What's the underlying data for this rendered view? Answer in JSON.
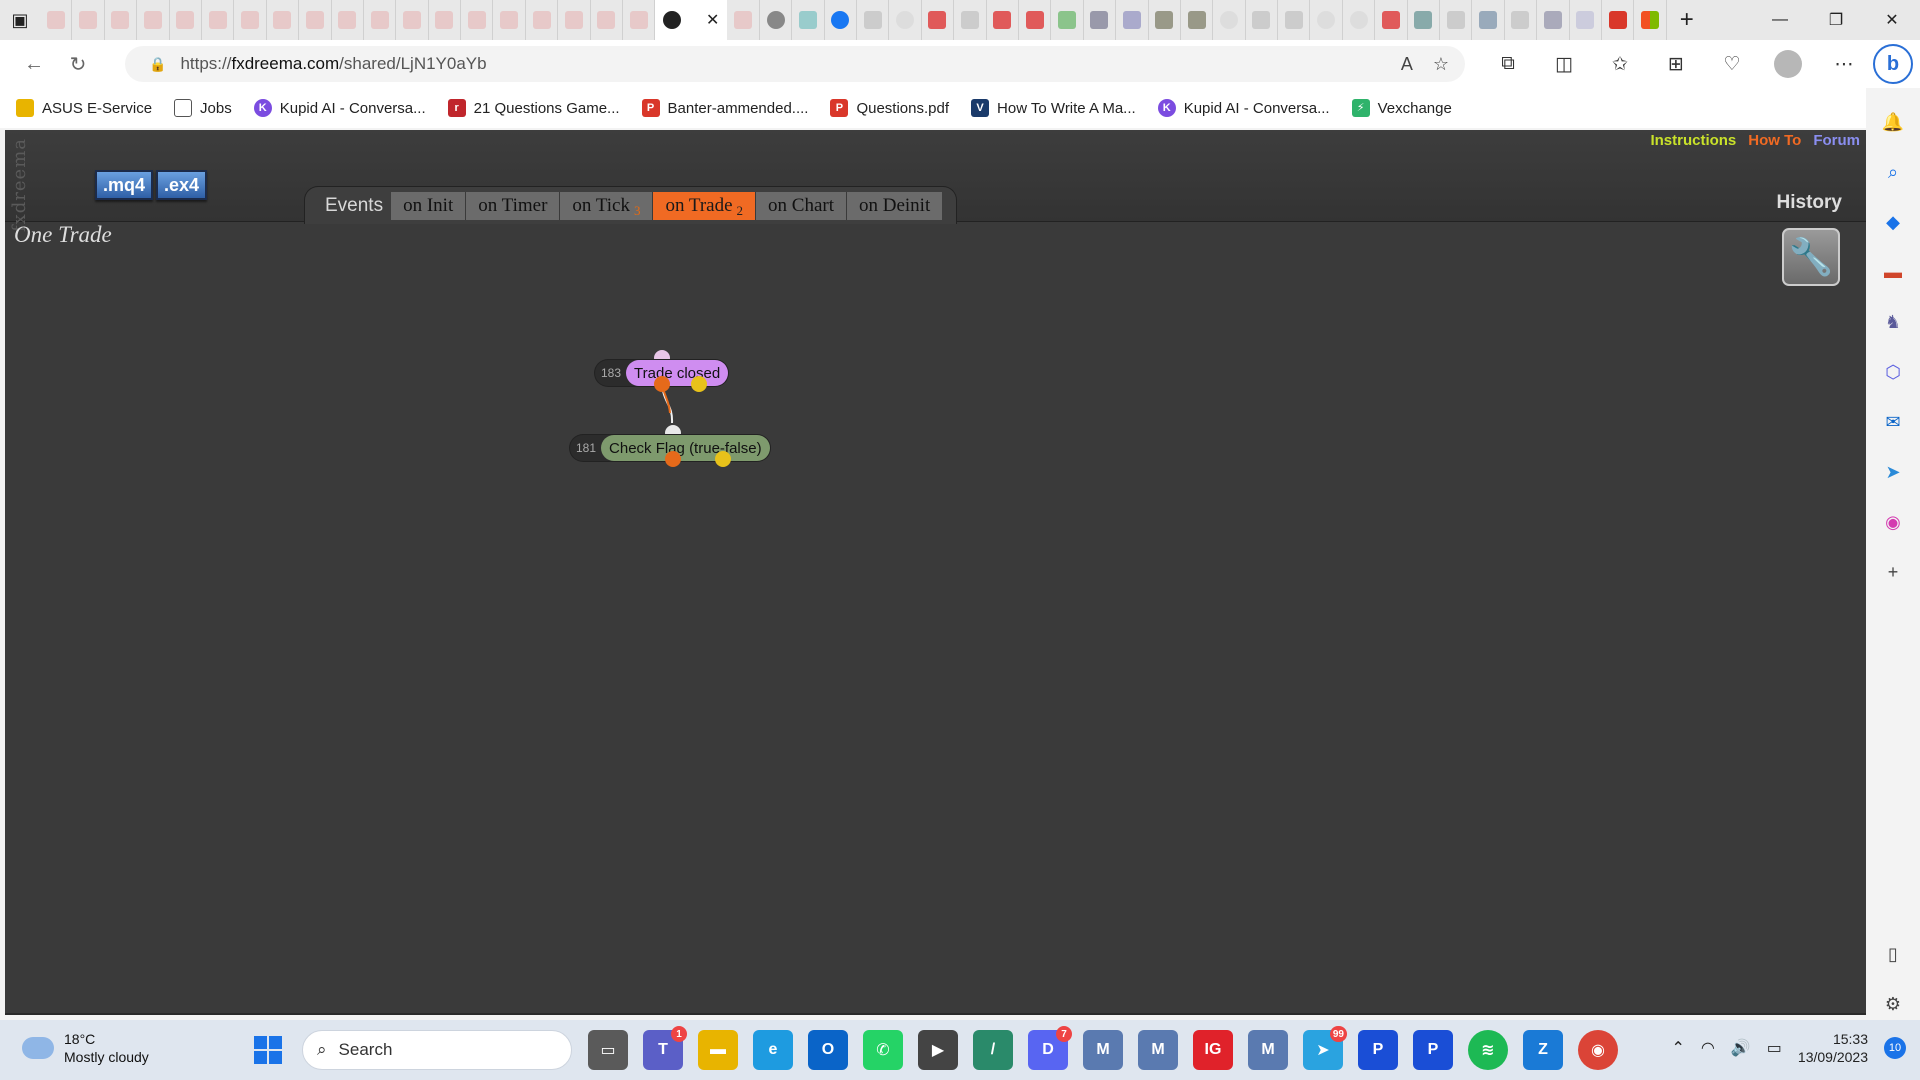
{
  "browser": {
    "url_prefix": "https://",
    "url_domain": "fxdreema.com",
    "url_path": "/shared/LjN1Y0aYb",
    "bookmarks": [
      {
        "label": "ASUS E-Service",
        "icon": "folder-icon",
        "color": "#e8b400"
      },
      {
        "label": "Jobs",
        "icon": "page-icon",
        "color": "#ffffff"
      },
      {
        "label": "Kupid AI - Conversa...",
        "icon": "kupid-icon",
        "color": "#7b4ce0"
      },
      {
        "label": "21 Questions Game...",
        "icon": "r-icon",
        "color": "#c0262c"
      },
      {
        "label": "Banter-ammended....",
        "icon": "pdf-icon",
        "color": "#d9372a"
      },
      {
        "label": "Questions.pdf",
        "icon": "pdf-icon",
        "color": "#d9372a"
      },
      {
        "label": "How To Write A Ma...",
        "icon": "v-icon",
        "color": "#1a3a6a"
      },
      {
        "label": "Kupid AI - Conversa...",
        "icon": "kupid-icon",
        "color": "#7b4ce0"
      },
      {
        "label": "Vexchange",
        "icon": "vexchange-icon",
        "color": "#2fb36b"
      }
    ]
  },
  "app": {
    "brand": "fxdreema",
    "download_mq4": ".mq4",
    "download_ex4": ".ex4",
    "links": {
      "instructions": "Instructions",
      "howto": "How To",
      "forum": "Forum"
    },
    "link_colors": {
      "instructions": "#c9e22a",
      "howto": "#f06a23",
      "forum": "#8a8ef0"
    },
    "history": "History",
    "events_label": "Events",
    "tabs": [
      {
        "label": "on Init",
        "count": ""
      },
      {
        "label": "on Timer",
        "count": ""
      },
      {
        "label": "on Tick",
        "count": "3"
      },
      {
        "label": "on Trade",
        "count": "2",
        "active": true
      },
      {
        "label": "on Chart",
        "count": ""
      },
      {
        "label": "on Deinit",
        "count": ""
      }
    ],
    "project_title": "One Trade",
    "blocks": [
      {
        "id": "183",
        "label": "Trade closed",
        "kind": "event"
      },
      {
        "id": "181",
        "label": "Check Flag (true-false)",
        "kind": "condition"
      }
    ]
  },
  "taskbar": {
    "weather_temp": "18°C",
    "weather_desc": "Mostly cloudy",
    "search_placeholder": "Search",
    "time": "15:33",
    "date": "13/09/2023",
    "notifications": "10",
    "badges": {
      "teams": "1",
      "discord": "7",
      "telegram": "99"
    }
  }
}
